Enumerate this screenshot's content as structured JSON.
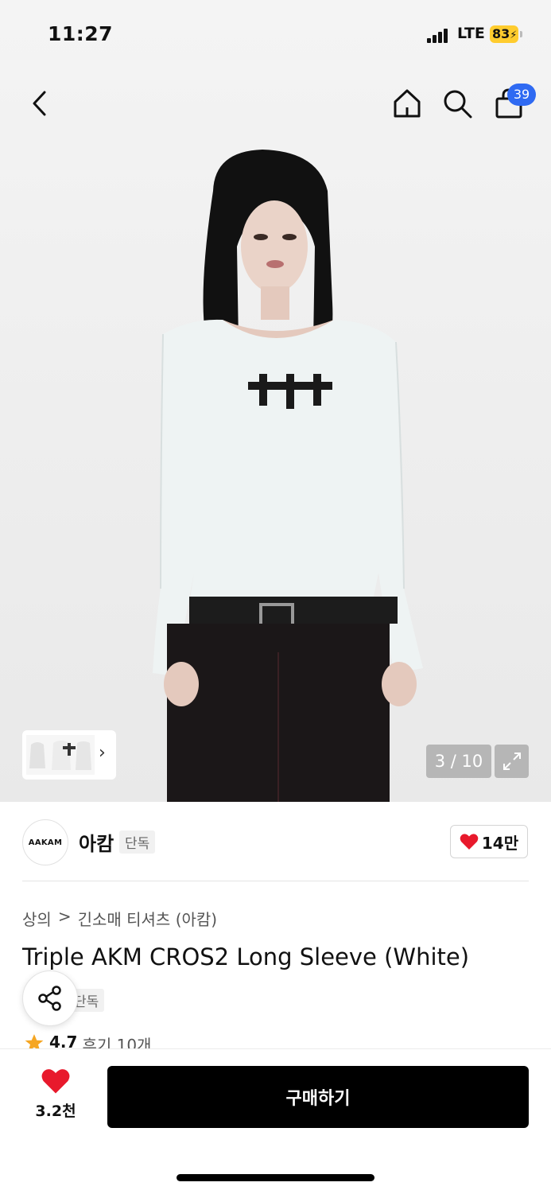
{
  "status_bar": {
    "time": "11:27",
    "network": "LTE",
    "battery": "83"
  },
  "header": {
    "cart_count": "39"
  },
  "gallery": {
    "counter": "3 / 10"
  },
  "brand": {
    "logo_text": "AAKAM",
    "name": "아캄",
    "tag": "단독",
    "likes": "14만"
  },
  "breadcrumb": {
    "level1": "상의",
    "separator": ">",
    "level2": "긴소매 티셔츠 (아캄)"
  },
  "product": {
    "title": "Triple AKM CROS2 Long Sleeve (White)",
    "tag": "단독",
    "rating": "4.7",
    "reviews": "후기 10개"
  },
  "bottom_bar": {
    "wish_count": "3.2천",
    "buy_label": "구매하기"
  },
  "colors": {
    "accent_badge": "#2f6af2",
    "heart": "#e8192c",
    "buy_button": "#000000",
    "battery": "#ffcc2e",
    "star": "#f5a623"
  },
  "icons": [
    "back-arrow-icon",
    "home-icon",
    "search-icon",
    "cart-icon",
    "expand-icon",
    "heart-icon",
    "share-icon",
    "star-icon",
    "chevron-right-icon"
  ]
}
